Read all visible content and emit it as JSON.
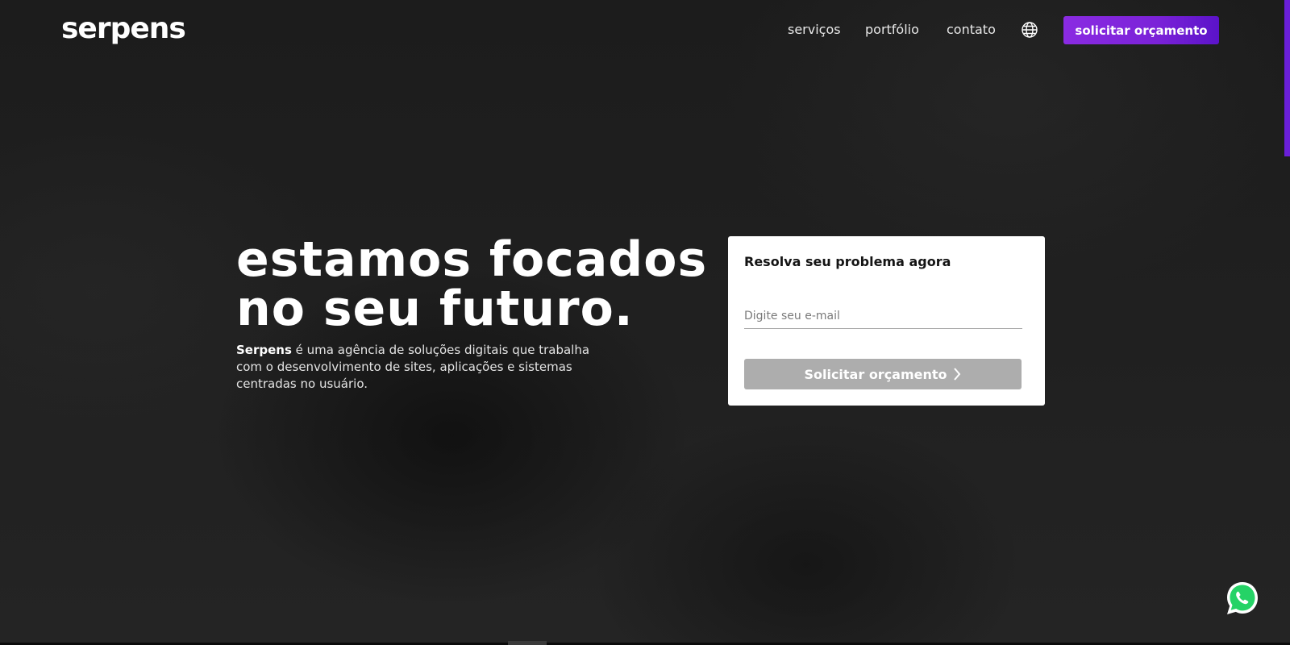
{
  "header": {
    "logo": "serpens",
    "nav": {
      "servicos": "serviços",
      "portfolio": "portfólio",
      "contato": "contato"
    },
    "language_icon": "globe-icon",
    "cta_label": "solicitar orçamento"
  },
  "hero": {
    "line1_light": "estamos",
    "line1_bold": "focados",
    "line2_light": "no seu",
    "line2_bold": "futuro.",
    "desc_brand": "Serpens",
    "desc_text": " é uma agência de soluções digitais que trabalha com o desenvolvimento de sites, aplicações e sistemas centradas no usuário."
  },
  "form": {
    "title": "Resolva seu problema agora",
    "email_placeholder": "Digite seu e-mail",
    "submit_label": "Solicitar orçamento",
    "submit_icon": "chevron-right-icon"
  },
  "floating": {
    "icon": "whatsapp-icon"
  },
  "colors": {
    "accent": "#8a2be2",
    "background": "#232323",
    "card": "#ffffff",
    "button_disabled": "#adadad",
    "whatsapp": "#25d366"
  }
}
